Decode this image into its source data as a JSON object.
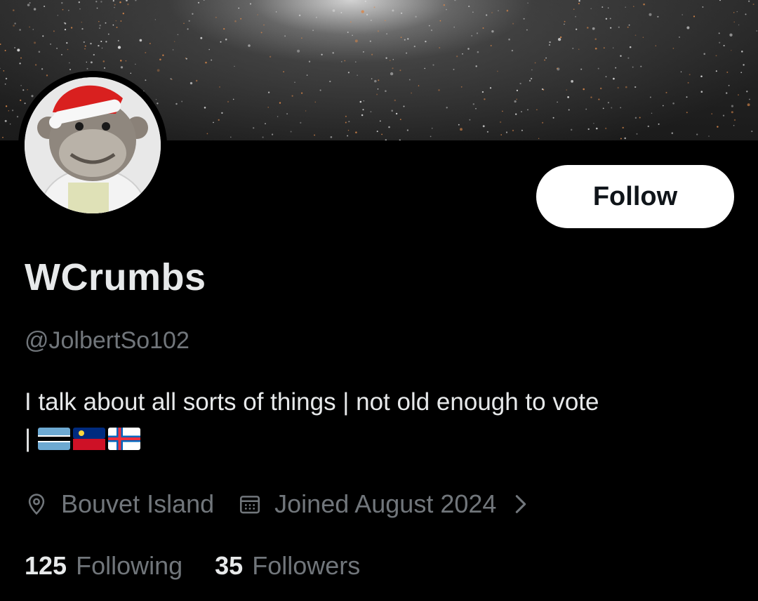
{
  "profile": {
    "display_name": "WCrumbs",
    "handle": "@JolbertSo102",
    "bio_line1": "I talk about all sorts of things | not old enough to vote",
    "bio_line2_prefix": "|",
    "bio_flags": [
      "flag-botswana-icon",
      "flag-liechtenstein-icon",
      "flag-faroe-islands-icon"
    ],
    "location": "Bouvet Island",
    "joined": "Joined August 2024",
    "following_count": "125",
    "following_label": "Following",
    "followers_count": "35",
    "followers_label": "Followers"
  },
  "actions": {
    "follow_label": "Follow"
  },
  "colors": {
    "background": "#000000",
    "primary_text": "#e7e9ea",
    "secondary_text": "#71767b",
    "follow_button_bg": "#ffffff",
    "follow_button_text": "#0f1419"
  },
  "icons": {
    "location": "location-pin-icon",
    "joined": "calendar-icon",
    "more": "chevron-right-icon"
  }
}
